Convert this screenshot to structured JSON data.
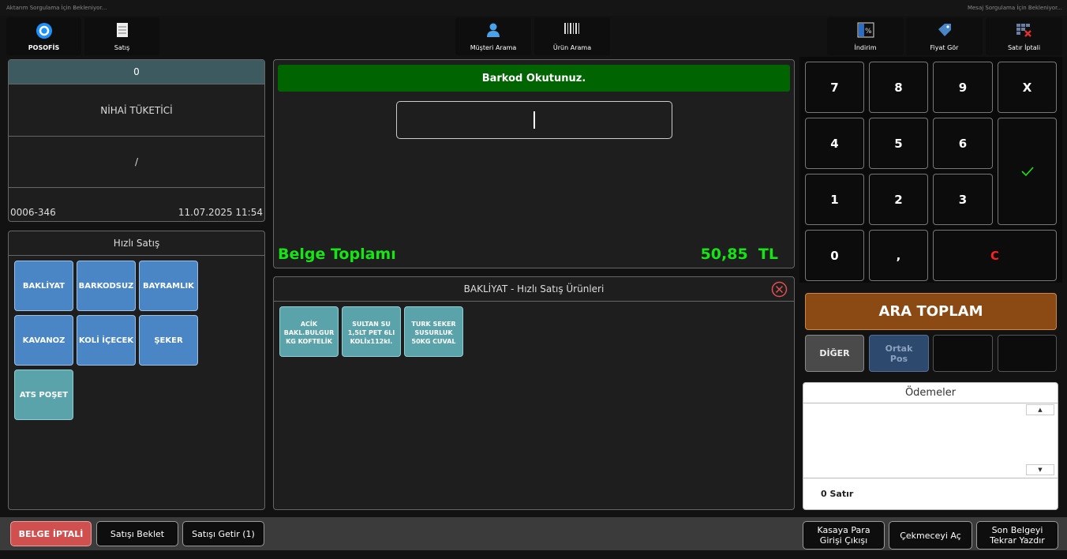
{
  "status": {
    "left": "Aktarım Sorgulama İçin Bekleniyor...",
    "right": "Mesaj Sorgulama İçin Bekleniyor..."
  },
  "toolbar": {
    "posofis": "POSOFİS",
    "satis": "Satış",
    "musteri_arama": "Müşteri Arama",
    "urun_arama": "Ürün Arama",
    "indirim": "İndirim",
    "fiyat_gor": "Fiyat Gör",
    "satir_iptali": "Satır İptali"
  },
  "customer": {
    "number": "0",
    "name": "NİHAİ TÜKETİCİ",
    "slash": "/",
    "doc_no": "0006-346",
    "datetime": "11.07.2025 11:54"
  },
  "quick_sale": {
    "title": "Hızlı Satış",
    "categories": [
      "BAKLİYAT",
      "BARKODSUZ",
      "BAYRAMLIK",
      "KAVANOZ",
      "KOLİ İÇECEK",
      "ŞEKER",
      "ATS POŞET"
    ]
  },
  "barcode": {
    "banner": "Barkod Okutunuz.",
    "input_value": "",
    "total_label": "Belge Toplamı",
    "total_value": "50,85",
    "currency": "TL"
  },
  "products": {
    "title": "BAKLİYAT - Hızlı Satış Ürünleri",
    "items": [
      {
        "l1": "ACİK",
        "l2": "BAKL.BULGUR",
        "l3": "KG KOFTELİK"
      },
      {
        "l1": "SULTAN SU",
        "l2": "1,5LT PET 6LI",
        "l3": "KOLİx112kl."
      },
      {
        "l1": "TURK SEKER",
        "l2": "SUSURLUK",
        "l3": "50KG CUVAL"
      }
    ]
  },
  "keypad": {
    "k7": "7",
    "k8": "8",
    "k9": "9",
    "kx": "X",
    "k4": "4",
    "k5": "5",
    "k6": "6",
    "k1": "1",
    "k2": "2",
    "k3": "3",
    "k0": "0",
    "kcomma": ",",
    "kc": "C"
  },
  "ara_toplam": "ARA TOPLAM",
  "diger": "DİĞER",
  "ortak_pos": "Ortak Pos",
  "payments": {
    "title": "Ödemeler",
    "rows": "0 Satır"
  },
  "bottom": {
    "belge_iptali": "BELGE İPTALİ",
    "satisi_beklet": "Satışı Beklet",
    "satisi_getir": "Satışı Getir (1)",
    "kasaya_para": "Kasaya Para Girişi Çıkışı",
    "cekmeceyi_ac": "Çekmeceyi Aç",
    "son_belge": "Son Belgeyi Tekrar Yazdır"
  },
  "colors": {
    "accent_green": "#16e416",
    "banner_green": "#006400",
    "ara_toplam": "#8b4a14",
    "cancel_red": "#d05050",
    "quick_blue": "#4a86c5",
    "teal": "#5aa3aa"
  }
}
